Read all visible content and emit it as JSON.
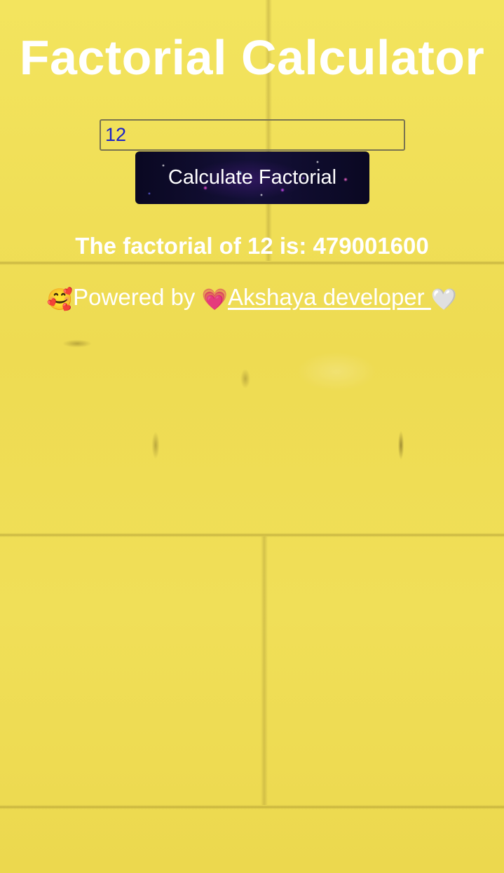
{
  "page": {
    "title": "Factorial Calculator"
  },
  "form": {
    "input_value": "12",
    "button_label": "Calculate Factorial"
  },
  "result": {
    "text": "The factorial of 12 is: 479001600"
  },
  "credit": {
    "prefix_emoji": "🥰",
    "prefix_text": "Powered by ",
    "link_emoji": "💗",
    "link_text": "Akshaya developer ",
    "suffix_emoji": "🤍"
  },
  "colors": {
    "background": "#f0e056",
    "text": "#ffffff",
    "input_text": "#1a22c8",
    "button_background": "#0c0a26"
  }
}
